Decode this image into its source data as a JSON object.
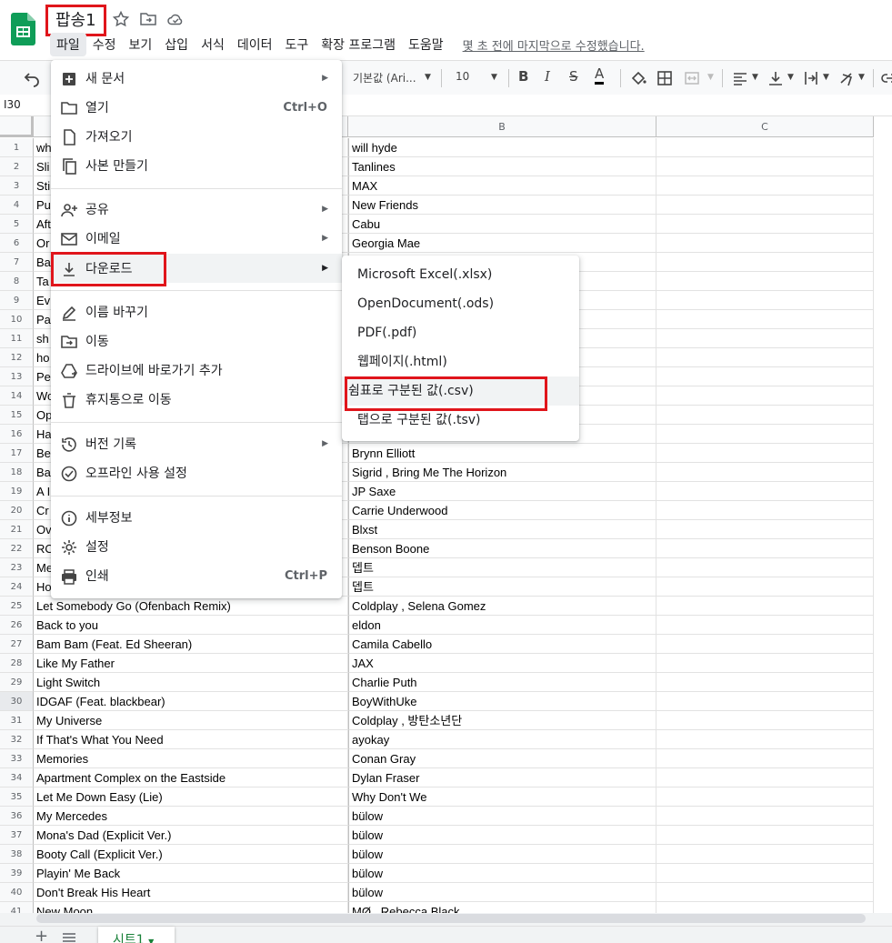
{
  "app": {
    "doc_title": "팝송1",
    "brand_color": "#0f9d58",
    "highlight_color": "#e0151b"
  },
  "menubar": {
    "items": [
      "파일",
      "수정",
      "보기",
      "삽입",
      "서식",
      "데이터",
      "도구",
      "확장 프로그램",
      "도움말"
    ],
    "active": "파일",
    "last_edit": "몇 초 전에 마지막으로 수정했습니다."
  },
  "toolbar": {
    "font": "기본값 (Ari...",
    "font_size": "10"
  },
  "name_box": "I30",
  "columns": [
    "B",
    "C"
  ],
  "rows": [
    {
      "n": "1",
      "a": "wh",
      "b": "will hyde"
    },
    {
      "n": "2",
      "a": "Sli",
      "b": "Tanlines"
    },
    {
      "n": "3",
      "a": "Sti",
      "b": "MAX"
    },
    {
      "n": "4",
      "a": "Pu",
      "b": "New Friends"
    },
    {
      "n": "5",
      "a": "Aft",
      "b": "Cabu"
    },
    {
      "n": "6",
      "a": "Or",
      "b": "Georgia Mae"
    },
    {
      "n": "7",
      "a": "Ba",
      "b": ""
    },
    {
      "n": "8",
      "a": "Ta",
      "b": ""
    },
    {
      "n": "9",
      "a": "Ev",
      "b": ""
    },
    {
      "n": "10",
      "a": "Pa",
      "b": ""
    },
    {
      "n": "11",
      "a": "sh",
      "b": ""
    },
    {
      "n": "12",
      "a": "ho",
      "b": ""
    },
    {
      "n": "13",
      "a": "Pe",
      "b": ""
    },
    {
      "n": "14",
      "a": "Wo",
      "b": ""
    },
    {
      "n": "15",
      "a": "Op",
      "b": ""
    },
    {
      "n": "16",
      "a": "Ha",
      "b": ""
    },
    {
      "n": "17",
      "a": "Be",
      "b": "Brynn Elliott"
    },
    {
      "n": "18",
      "a": "Ba",
      "b": "Sigrid , Bring Me The Horizon"
    },
    {
      "n": "19",
      "a": "A I",
      "b": "JP Saxe"
    },
    {
      "n": "20",
      "a": "Cr",
      "b": "Carrie Underwood"
    },
    {
      "n": "21",
      "a": "Ov",
      "b": "Blxst"
    },
    {
      "n": "22",
      "a": "RO",
      "b": "Benson Boone"
    },
    {
      "n": "23",
      "a": "Me",
      "b": "뎁트"
    },
    {
      "n": "24",
      "a": "Ho",
      "b": "뎁트"
    },
    {
      "n": "25",
      "a": "Let Somebody Go (Ofenbach Remix)",
      "b": "Coldplay , Selena Gomez"
    },
    {
      "n": "26",
      "a": "Back to you",
      "b": "eldon"
    },
    {
      "n": "27",
      "a": "Bam Bam (Feat. Ed Sheeran)",
      "b": "Camila Cabello"
    },
    {
      "n": "28",
      "a": "Like My Father",
      "b": "JAX"
    },
    {
      "n": "29",
      "a": "Light Switch",
      "b": "Charlie Puth"
    },
    {
      "n": "30",
      "a": "IDGAF (Feat. blackbear)",
      "b": "BoyWithUke"
    },
    {
      "n": "31",
      "a": "My Universe",
      "b": "Coldplay , 방탄소년단"
    },
    {
      "n": "32",
      "a": "If That's What You Need",
      "b": "ayokay"
    },
    {
      "n": "33",
      "a": "Memories",
      "b": "Conan Gray"
    },
    {
      "n": "34",
      "a": "Apartment Complex on the Eastside",
      "b": "Dylan Fraser"
    },
    {
      "n": "35",
      "a": "Let Me Down Easy (Lie)",
      "b": "Why Don't We"
    },
    {
      "n": "36",
      "a": "My Mercedes",
      "b": "bülow"
    },
    {
      "n": "37",
      "a": "Mona's Dad (Explicit Ver.)",
      "b": "bülow"
    },
    {
      "n": "38",
      "a": "Booty Call (Explicit Ver.)",
      "b": "bülow"
    },
    {
      "n": "39",
      "a": "Playin' Me Back",
      "b": "bülow"
    },
    {
      "n": "40",
      "a": "Don't Break His Heart",
      "b": "bülow"
    },
    {
      "n": "41",
      "a": "New Moon",
      "b": "MØ , Rebecca Black"
    }
  ],
  "file_menu": {
    "items": [
      {
        "label": "새 문서",
        "icon": "add-box-icon",
        "shortcut": "",
        "arrow": true
      },
      {
        "label": "열기",
        "icon": "folder-icon",
        "shortcut": "Ctrl+O",
        "arrow": false
      },
      {
        "label": "가져오기",
        "icon": "file-import-icon",
        "shortcut": "",
        "arrow": false
      },
      {
        "label": "사본 만들기",
        "icon": "copy-icon",
        "shortcut": "",
        "arrow": false
      },
      {
        "label": "공유",
        "icon": "person-add-icon",
        "shortcut": "",
        "arrow": true
      },
      {
        "label": "이메일",
        "icon": "mail-icon",
        "shortcut": "",
        "arrow": true
      },
      {
        "label": "다운로드",
        "icon": "download-icon",
        "shortcut": "",
        "arrow": true
      },
      {
        "label": "이름 바꾸기",
        "icon": "rename-icon",
        "shortcut": "",
        "arrow": false
      },
      {
        "label": "이동",
        "icon": "move-folder-icon",
        "shortcut": "",
        "arrow": false
      },
      {
        "label": "드라이브에 바로가기 추가",
        "icon": "drive-shortcut-icon",
        "shortcut": "",
        "arrow": false
      },
      {
        "label": "휴지통으로 이동",
        "icon": "trash-icon",
        "shortcut": "",
        "arrow": false
      },
      {
        "label": "버전 기록",
        "icon": "history-icon",
        "shortcut": "",
        "arrow": true
      },
      {
        "label": "오프라인 사용 설정",
        "icon": "offline-icon",
        "shortcut": "",
        "arrow": false
      },
      {
        "label": "세부정보",
        "icon": "info-icon",
        "shortcut": "",
        "arrow": false
      },
      {
        "label": "설정",
        "icon": "settings-icon",
        "shortcut": "",
        "arrow": false
      },
      {
        "label": "인쇄",
        "icon": "print-icon",
        "shortcut": "Ctrl+P",
        "arrow": false
      }
    ],
    "highlighted": "다운로드"
  },
  "download_menu": {
    "items": [
      "Microsoft Excel(.xlsx)",
      "OpenDocument(.ods)",
      "PDF(.pdf)",
      "웹페이지(.html)",
      "쉼표로 구분된 값(.csv)",
      "탭으로 구분된 값(.tsv)"
    ],
    "highlighted": "쉼표로 구분된 값(.csv)"
  },
  "sheet_tabs": {
    "add_label": "+",
    "active_tab": "시트1"
  }
}
